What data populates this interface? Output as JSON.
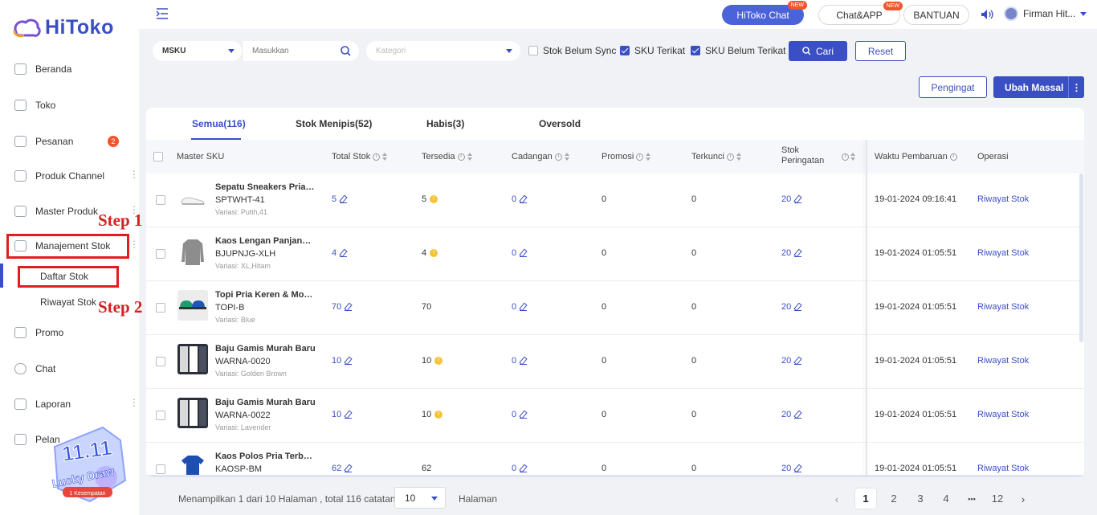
{
  "app": {
    "logo_text": "HiToko"
  },
  "sidebar": {
    "items": [
      {
        "label": "Beranda"
      },
      {
        "label": "Toko"
      },
      {
        "label": "Pesanan",
        "badge": "2"
      },
      {
        "label": "Produk Channel"
      },
      {
        "label": "Master Produk"
      },
      {
        "label": "Manajement Stok"
      },
      {
        "label": "Promo"
      },
      {
        "label": "Chat"
      },
      {
        "label": "Laporan"
      },
      {
        "label": "Pelan"
      }
    ],
    "sub_items": [
      {
        "label": "Daftar Stok"
      },
      {
        "label": "Riwayat Stok"
      }
    ]
  },
  "annotations": {
    "step1": "Step 1",
    "step2": "Step 2"
  },
  "promo_badge": {
    "title": "11.11",
    "subtitle": "Lucky Draw",
    "note": "1 Kesempatan"
  },
  "topbar": {
    "hitoko_chat": "HiToko Chat",
    "chat_app": "Chat&APP",
    "new_tag": "NEW",
    "bantuan": "BANTUAN",
    "user_name": "Firman Hit..."
  },
  "filters": {
    "sku_type": "MSKU",
    "search_placeholder": "Masukkan",
    "category_placeholder": "Kategori",
    "chk_stok_belum_sync": "Stok Belum Sync",
    "chk_sku_terikat": "SKU Terikat",
    "chk_sku_belum_terikat": "SKU Belum Terikat",
    "search_button": "Cari",
    "reset_button": "Reset",
    "pengingat_button": "Pengingat",
    "ubah_massal_button": "Ubah Massal"
  },
  "tabs": [
    {
      "label": "Semua(116)",
      "active": true
    },
    {
      "label": "Stok Menipis(52)"
    },
    {
      "label": "Habis(3)"
    },
    {
      "label": "Oversold"
    }
  ],
  "columns": {
    "master_sku": "Master SKU",
    "total_stok": "Total Stok",
    "tersedia": "Tersedia",
    "cadangan": "Cadangan",
    "promosi": "Promosi",
    "terkunci": "Terkunci",
    "stok_peringatan_1": "Stok",
    "stok_peringatan_2": "Peringatan",
    "waktu_pembaruan": "Waktu Pembaruan",
    "operasi": "Operasi"
  },
  "rows": [
    {
      "name": "Sepatu Sneakers Pria Wanita",
      "sku": "SPTWHT-41",
      "variant": "Variasi: Putih,41",
      "total": "5",
      "tersedia": "5",
      "warn": true,
      "cadangan": "0",
      "promosi": "0",
      "terkunci": "0",
      "peringatan": "20",
      "waktu": "19-01-2024 09:16:41",
      "operasi": "Riwayat Stok",
      "thumb": "shoe"
    },
    {
      "name": "Kaos Lengan Panjang Pria",
      "sku": "BJUPNJG-XLH",
      "variant": "Variasi: XL,Hitam",
      "total": "4",
      "tersedia": "4",
      "warn": true,
      "cadangan": "0",
      "promosi": "0",
      "terkunci": "0",
      "peringatan": "20",
      "waktu": "19-01-2024 01:05:51",
      "operasi": "Riwayat Stok",
      "thumb": "longsleeve"
    },
    {
      "name": "Topi Pria Keren & Modis",
      "sku": "TOPI-B",
      "variant": "Variasi: Blue",
      "total": "70",
      "tersedia": "70",
      "warn": false,
      "cadangan": "0",
      "promosi": "0",
      "terkunci": "0",
      "peringatan": "20",
      "waktu": "19-01-2024 01:05:51",
      "operasi": "Riwayat Stok",
      "thumb": "caps"
    },
    {
      "name": "Baju Gamis Murah Baru",
      "sku": "WARNA-0020",
      "variant": "Variasi: Golden Brown",
      "total": "10",
      "tersedia": "10",
      "warn": true,
      "cadangan": "0",
      "promosi": "0",
      "terkunci": "0",
      "peringatan": "20",
      "waktu": "19-01-2024 01:05:51",
      "operasi": "Riwayat Stok",
      "thumb": "gamis"
    },
    {
      "name": "Baju Gamis Murah Baru",
      "sku": "WARNA-0022",
      "variant": "Variasi: Lavender",
      "total": "10",
      "tersedia": "10",
      "warn": true,
      "cadangan": "0",
      "promosi": "0",
      "terkunci": "0",
      "peringatan": "20",
      "waktu": "19-01-2024 01:05:51",
      "operasi": "Riwayat Stok",
      "thumb": "gamis"
    },
    {
      "name": "Kaos Polos Pria Terbaru",
      "sku": "KAOSP-BM",
      "variant": "",
      "total": "62",
      "tersedia": "62",
      "warn": false,
      "cadangan": "0",
      "promosi": "0",
      "terkunci": "0",
      "peringatan": "20",
      "waktu": "19-01-2024 01:05:51",
      "operasi": "Riwayat Stok",
      "thumb": "tshirt"
    }
  ],
  "footer": {
    "summary": "Menampilkan 1 dari 10 Halaman , total 116 catatan",
    "page_size": "10",
    "halaman": "Halaman",
    "pages": [
      "1",
      "2",
      "3",
      "4",
      "•••",
      "12"
    ],
    "current_page": "1"
  },
  "colors": {
    "accent": "#3b4fc4",
    "annotation": "#e01e1e",
    "badge": "#f2552c"
  }
}
